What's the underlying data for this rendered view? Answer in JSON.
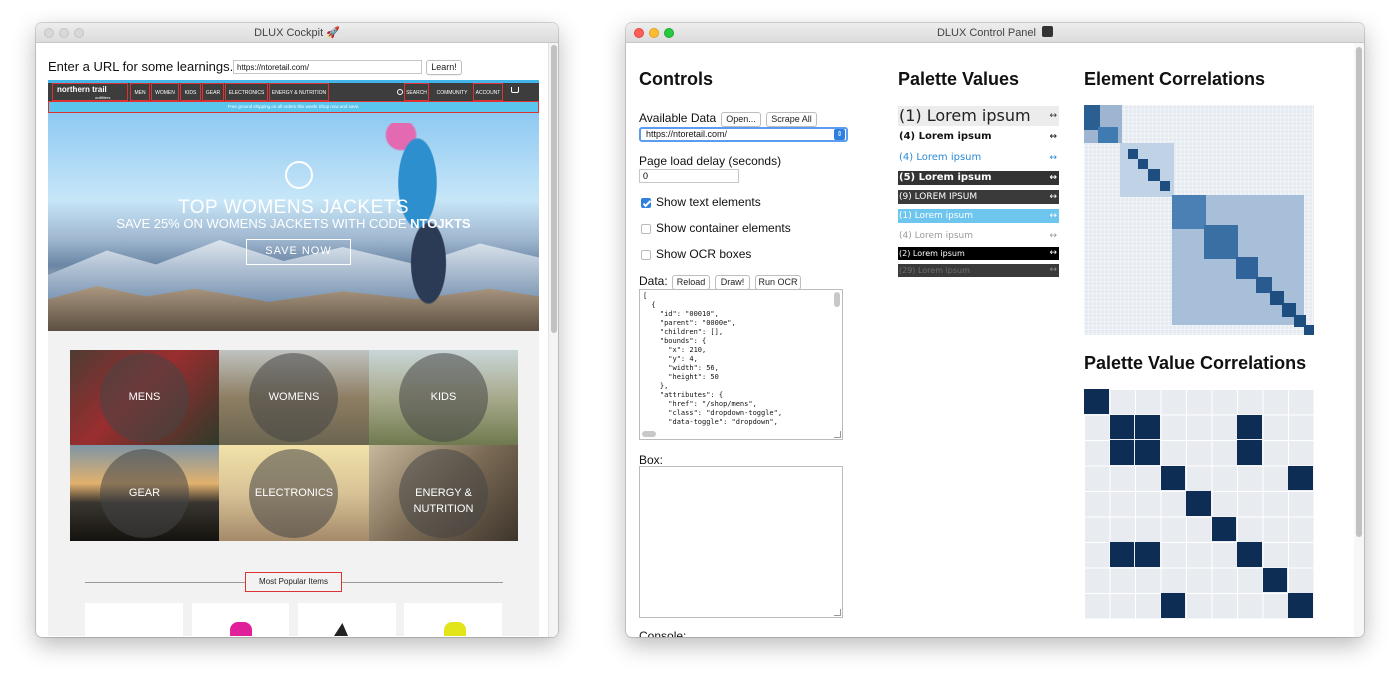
{
  "left_window": {
    "title": "DLUX Cockpit 🚀",
    "url_prompt": "Enter a URL for some learnings...",
    "url_value": "https://ntoretail.com/",
    "learn_button": "Learn!",
    "site": {
      "logo": "northern trail",
      "logo_sub": "outfitters",
      "nav_items": [
        "MEN",
        "WOMEN",
        "KIDS",
        "GEAR",
        "ELECTRONICS",
        "ENERGY & NUTRITION"
      ],
      "search_label": "SEARCH",
      "community_label": "COMMUNITY",
      "account_label": "ACCOUNT",
      "banner_text": "Free ground shipping on all orders this week! Shop now and save.",
      "hero_title": "TOP WOMENS JACKETS",
      "hero_subtitle": "SAVE 25% ON WOMENS JACKETS WITH CODE",
      "hero_code": "NTOJKTS",
      "hero_button": "SAVE NOW",
      "categories": [
        "MENS",
        "WOMENS",
        "KIDS",
        "GEAR",
        "ELECTRONICS",
        "ENERGY & NUTRITION"
      ],
      "popular_title": "Most Popular Items"
    }
  },
  "right_window": {
    "title": "DLUX Control Panel",
    "controls_heading": "Controls",
    "available_data_label": "Available Data",
    "open_button": "Open...",
    "scrape_all_button": "Scrape All",
    "data_select_value": "https://ntoretail.com/",
    "delay_label": "Page load delay (seconds)",
    "delay_value": "0",
    "checkboxes": [
      {
        "label": "Show text elements",
        "checked": true
      },
      {
        "label": "Show container elements",
        "checked": false
      },
      {
        "label": "Show OCR boxes",
        "checked": false
      }
    ],
    "data_label": "Data:",
    "reload_button": "Reload",
    "draw_button": "Draw!",
    "run_ocr_button": "Run OCR",
    "data_json": "[\n  {\n    \"id\": \"00010\",\n    \"parent\": \"0000e\",\n    \"children\": [],\n    \"bounds\": {\n      \"x\": 210,\n      \"y\": 4,\n      \"width\": 56,\n      \"height\": 50\n    },\n    \"attributes\": {\n      \"href\": \"/shop/mens\",\n      \"class\": \"dropdown-toggle\",\n      \"data-toggle\": \"dropdown\",",
    "box_label": "Box:",
    "console_label": "Console:",
    "palette_heading": "Palette Values",
    "palette": [
      {
        "text": "(1) Lorem ipsum",
        "fg": "#222222",
        "bg": "#ececec"
      },
      {
        "text": "(4) Lorem ipsum",
        "fg": "#111111",
        "bg": "#ffffff"
      },
      {
        "text": "(4) Lorem ipsum",
        "fg": "#2b8ad6",
        "bg": "#ffffff"
      },
      {
        "text": "(5) Lorem ipsum",
        "fg": "#ffffff",
        "bg": "#333333"
      },
      {
        "text": "(9) LOREM IPSUM",
        "fg": "#ffffff",
        "bg": "#3a3a3a"
      },
      {
        "text": "(1) Lorem ipsum",
        "fg": "#ffffff",
        "bg": "#6ec6ee"
      },
      {
        "text": "(4) Lorem ipsum",
        "fg": "#9a9a9a",
        "bg": "#ffffff"
      },
      {
        "text": "(2) Lorem ipsum",
        "fg": "#ffffff",
        "bg": "#000000"
      },
      {
        "text": "(29) Lorem ipsum",
        "fg": "#6f6f6f",
        "bg": "#3a3a3a"
      }
    ],
    "palette_arrow": "↔",
    "element_corr_heading": "Element Correlations",
    "palette_corr_heading": "Palette Value Correlations",
    "palette_corr_matrix": [
      [
        1,
        0,
        0,
        0,
        0,
        0,
        0,
        0,
        0
      ],
      [
        0,
        1,
        1,
        0,
        0,
        0,
        1,
        0,
        0
      ],
      [
        0,
        1,
        1,
        0,
        0,
        0,
        1,
        0,
        0
      ],
      [
        0,
        0,
        0,
        1,
        0,
        0,
        0,
        0,
        1
      ],
      [
        0,
        0,
        0,
        0,
        1,
        0,
        0,
        0,
        0
      ],
      [
        0,
        0,
        0,
        0,
        0,
        1,
        0,
        0,
        0
      ],
      [
        0,
        1,
        1,
        0,
        0,
        0,
        1,
        0,
        0
      ],
      [
        0,
        0,
        0,
        0,
        0,
        0,
        0,
        1,
        0
      ],
      [
        0,
        0,
        0,
        1,
        0,
        0,
        0,
        0,
        1
      ]
    ]
  }
}
